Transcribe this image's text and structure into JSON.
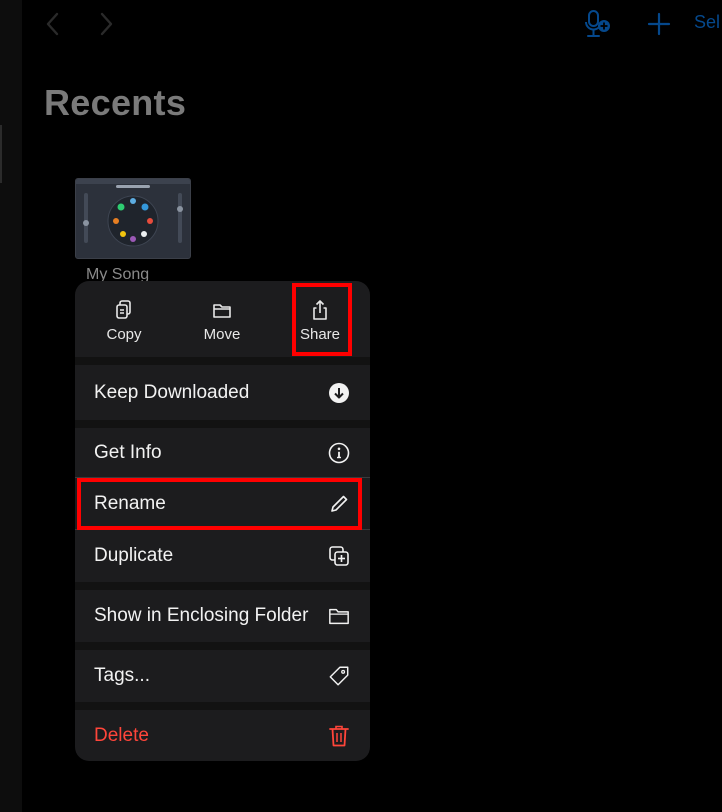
{
  "header": {
    "back_icon": "chevron-left-icon",
    "forward_icon": "chevron-right-icon",
    "voice_memo_icon": "microphone-plus-icon",
    "add_icon": "plus-icon",
    "select_label": "Sel"
  },
  "page": {
    "title": "Recents"
  },
  "document": {
    "name": "My Song"
  },
  "context_menu": {
    "actions": [
      {
        "label": "Copy",
        "icon": "copy-icon"
      },
      {
        "label": "Move",
        "icon": "folder-icon"
      },
      {
        "label": "Share",
        "icon": "share-icon"
      }
    ],
    "items": [
      {
        "label": "Keep Downloaded",
        "icon": "download-circle-icon"
      },
      {
        "label": "Get Info",
        "icon": "info-circle-icon"
      },
      {
        "label": "Rename",
        "icon": "pencil-icon"
      },
      {
        "label": "Duplicate",
        "icon": "duplicate-icon"
      },
      {
        "label": "Show in Enclosing Folder",
        "icon": "folder-icon"
      },
      {
        "label": "Tags...",
        "icon": "tag-icon"
      },
      {
        "label": "Delete",
        "icon": "trash-icon"
      }
    ]
  },
  "colors": {
    "accent": "#0a84ff",
    "menu_background": "#1c1c1e",
    "destructive": "#ff453a",
    "highlight": "#ff0000"
  }
}
